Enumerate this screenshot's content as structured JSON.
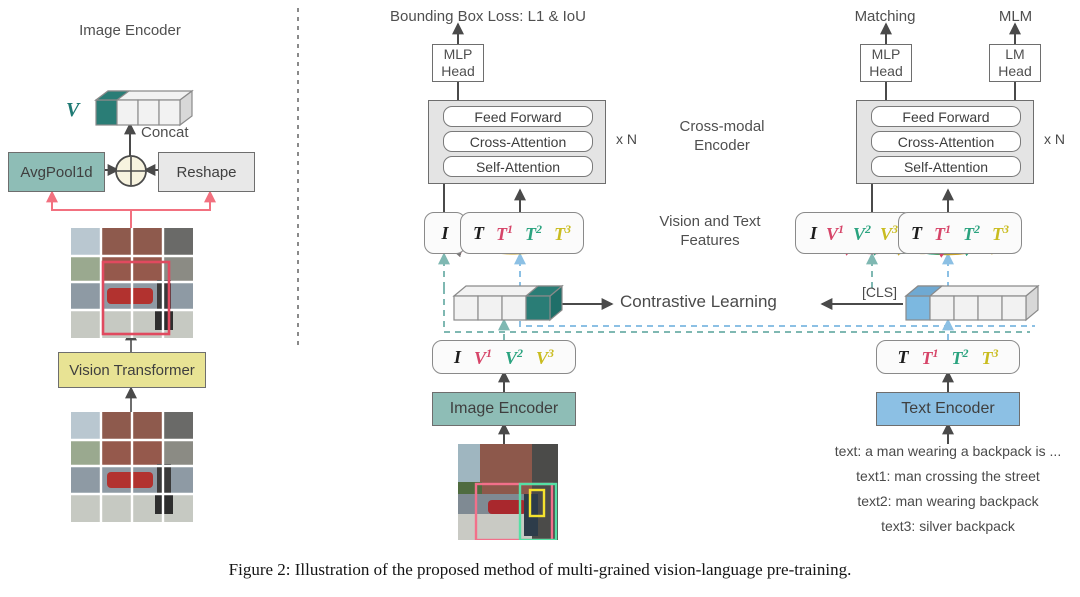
{
  "figure": {
    "caption": "Figure 2: Illustration of the proposed method of multi-grained vision-language pre-training."
  },
  "left_panel": {
    "title": "Image Encoder",
    "v_symbol": "V",
    "concat_label": "Concat",
    "avgpool_label": "AvgPool1d",
    "reshape_label": "Reshape",
    "plus_symbol": "+",
    "vit_label": "Vision Transformer"
  },
  "middle_panel": {
    "loss_label": "Bounding Box Loss: L1 & IoU",
    "mlp_head_label": "MLP\nHead",
    "encoder_layers": [
      "Feed Forward",
      "Cross-Attention",
      "Self-Attention"
    ],
    "repeat_label": "x N",
    "cross_modal_label": "Cross-modal\nEncoder",
    "features_label": "Vision and Text\nFeatures",
    "i_token": "I",
    "text_tokens": [
      {
        "base": "T",
        "sup": "",
        "color": "c-black"
      },
      {
        "base": "T",
        "sup": "1",
        "color": "c-red"
      },
      {
        "base": "T",
        "sup": "2",
        "color": "c-green"
      },
      {
        "base": "T",
        "sup": "3",
        "color": "c-olive"
      }
    ],
    "contrastive_label": "Contrastive Learning",
    "vision_tokens": [
      {
        "base": "I",
        "sup": "",
        "color": "c-black"
      },
      {
        "base": "V",
        "sup": "1",
        "color": "c-red"
      },
      {
        "base": "V",
        "sup": "2",
        "color": "c-green"
      },
      {
        "base": "V",
        "sup": "3",
        "color": "c-olive"
      }
    ],
    "image_encoder_label": "Image Encoder"
  },
  "right_panel": {
    "matching_label": "Matching",
    "mlm_label": "MLM",
    "mlp_head_label": "MLP\nHead",
    "lm_head_label": "LM\nHead",
    "encoder_layers": [
      "Feed Forward",
      "Cross-Attention",
      "Self-Attention"
    ],
    "repeat_label": "x N",
    "cls_label": "[CLS]",
    "vision_tokens": [
      {
        "base": "I",
        "sup": "",
        "color": "c-black"
      },
      {
        "base": "V",
        "sup": "1",
        "color": "c-red"
      },
      {
        "base": "V",
        "sup": "2",
        "color": "c-green"
      },
      {
        "base": "V",
        "sup": "3",
        "color": "c-olive"
      }
    ],
    "text_tokens": [
      {
        "base": "T",
        "sup": "",
        "color": "c-black"
      },
      {
        "base": "T",
        "sup": "1",
        "color": "c-red"
      },
      {
        "base": "T",
        "sup": "2",
        "color": "c-green"
      },
      {
        "base": "T",
        "sup": "3",
        "color": "c-olive"
      }
    ],
    "text_encoder_label": "Text Encoder",
    "text_inputs": [
      "text: a man wearing a backpack is ...",
      "text1: man crossing the street",
      "text2: man wearing backpack",
      "text3: silver backpack"
    ]
  },
  "colors": {
    "teal": "#8ebdb6",
    "teal_dark": "#2a7d76",
    "yellow": "#e8e394",
    "blue": "#8cc0e4",
    "gray": "#e4e4e4",
    "red_arrow": "#f2707f",
    "dashed_teal": "#7fb8b2",
    "dashed_blue": "#8cc0e4",
    "token_red": "#d64468",
    "token_green": "#2aa37f",
    "token_olive": "#c9bc1f"
  }
}
